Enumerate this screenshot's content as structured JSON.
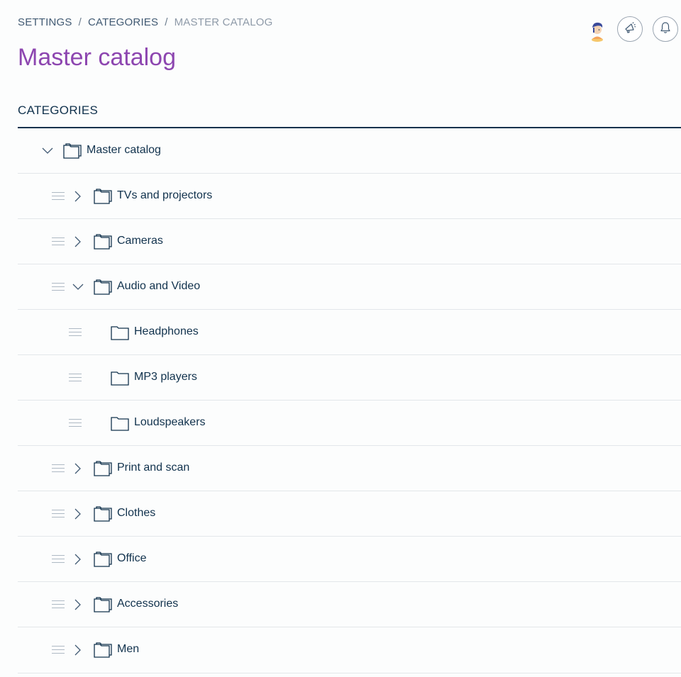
{
  "breadcrumb": {
    "items": [
      "SETTINGS",
      "CATEGORIES",
      "MASTER CATALOG"
    ],
    "separator": "/"
  },
  "page": {
    "title": "Master catalog"
  },
  "header_actions": {
    "avatar_icon": "user-avatar-icon",
    "announcements_icon": "megaphone-icon",
    "notifications_icon": "bell-icon"
  },
  "categories": {
    "section_title": "CATEGORIES",
    "root": {
      "label": "Master catalog",
      "expanded": true
    },
    "items": [
      {
        "label": "TVs and projectors",
        "level": 1,
        "expanded": false,
        "has_children": true
      },
      {
        "label": "Cameras",
        "level": 1,
        "expanded": false,
        "has_children": true
      },
      {
        "label": "Audio and Video",
        "level": 1,
        "expanded": true,
        "has_children": true
      },
      {
        "label": "Headphones",
        "level": 2,
        "has_children": false
      },
      {
        "label": "MP3 players",
        "level": 2,
        "has_children": false
      },
      {
        "label": "Loudspeakers",
        "level": 2,
        "has_children": false
      },
      {
        "label": "Print and scan",
        "level": 1,
        "expanded": false,
        "has_children": true
      },
      {
        "label": "Clothes",
        "level": 1,
        "expanded": false,
        "has_children": true
      },
      {
        "label": "Office",
        "level": 1,
        "expanded": false,
        "has_children": true
      },
      {
        "label": "Accessories",
        "level": 1,
        "expanded": false,
        "has_children": true
      },
      {
        "label": "Men",
        "level": 1,
        "expanded": false,
        "has_children": true
      }
    ]
  },
  "colors": {
    "title_accent": "#8d46b0",
    "text_primary": "#11324d",
    "breadcrumb_current": "#8e9aa8",
    "divider": "#e3e7ea"
  }
}
